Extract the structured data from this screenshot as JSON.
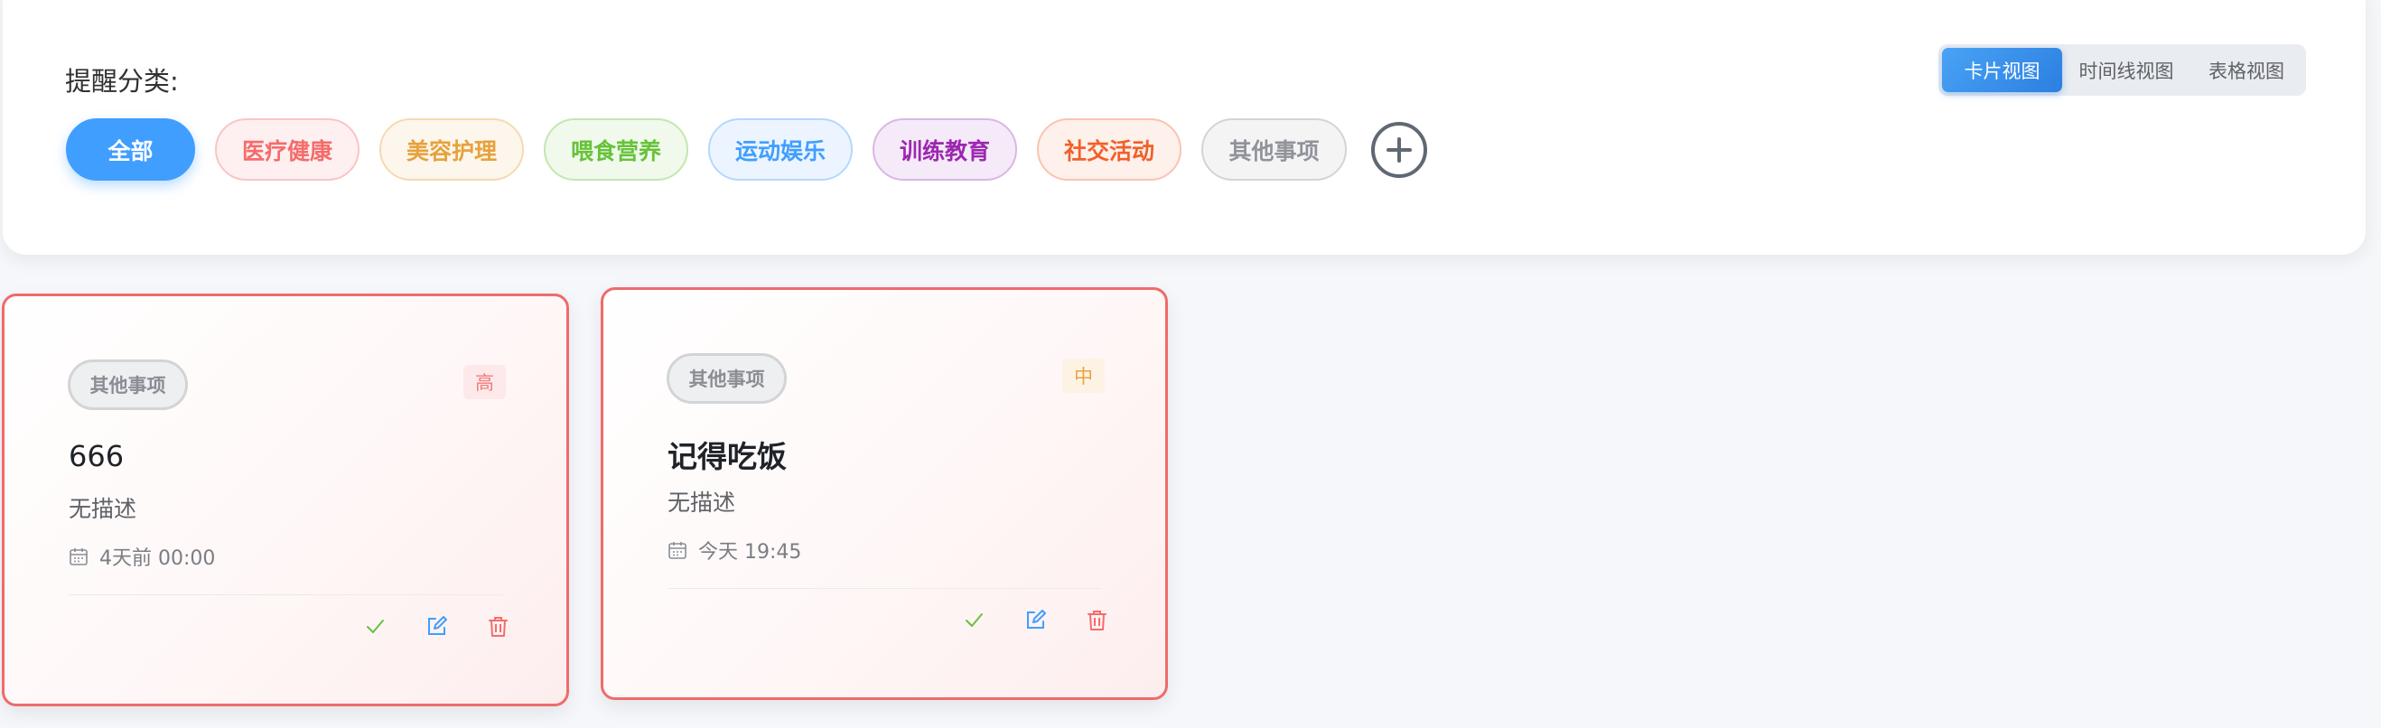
{
  "filter": {
    "title": "提醒分类:",
    "view_modes": [
      {
        "label": "卡片视图",
        "active": true
      },
      {
        "label": "时间线视图",
        "active": false
      },
      {
        "label": "表格视图",
        "active": false
      }
    ],
    "categories": [
      {
        "label": "全部",
        "active": true,
        "color": "#ffffff",
        "bg": "#409eff",
        "border": "#409eff"
      },
      {
        "label": "医疗健康",
        "active": false,
        "color": "#f56c6c",
        "bg": "#fef0f0",
        "border": "#fbc4c4"
      },
      {
        "label": "美容护理",
        "active": false,
        "color": "#e6a23c",
        "bg": "#fdf6ec",
        "border": "#f5dab1"
      },
      {
        "label": "喂食营养",
        "active": false,
        "color": "#67c23a",
        "bg": "#f0f9eb",
        "border": "#c2e7b0"
      },
      {
        "label": "运动娱乐",
        "active": false,
        "color": "#409eff",
        "bg": "#ecf5ff",
        "border": "#b3d8ff"
      },
      {
        "label": "训练教育",
        "active": false,
        "color": "#9c27b0",
        "bg": "#f5eaf8",
        "border": "#dbb6e6"
      },
      {
        "label": "社交活动",
        "active": false,
        "color": "#f0602a",
        "bg": "#fef0ea",
        "border": "#f9c4b0"
      },
      {
        "label": "其他事项",
        "active": false,
        "color": "#909399",
        "bg": "#f4f4f5",
        "border": "#d3d4d6"
      }
    ],
    "add_icon": "plus-circle-icon"
  },
  "reminders": [
    {
      "category": "其他事项",
      "priority": "高",
      "priority_level": "high",
      "title": "666",
      "description": "无描述",
      "time": "4天前 00:00"
    },
    {
      "category": "其他事项",
      "priority": "中",
      "priority_level": "medium",
      "title": "记得吃饭",
      "description": "无描述",
      "time": "今天 19:45"
    }
  ],
  "icons": {
    "time": "calendar-icon",
    "complete": "check-icon",
    "edit": "edit-icon",
    "delete": "trash-icon"
  },
  "colors": {
    "accent": "#409eff",
    "card_border": "#ef6b6b",
    "complete": "#67c23a",
    "edit": "#409eff",
    "delete": "#f56c6c"
  }
}
